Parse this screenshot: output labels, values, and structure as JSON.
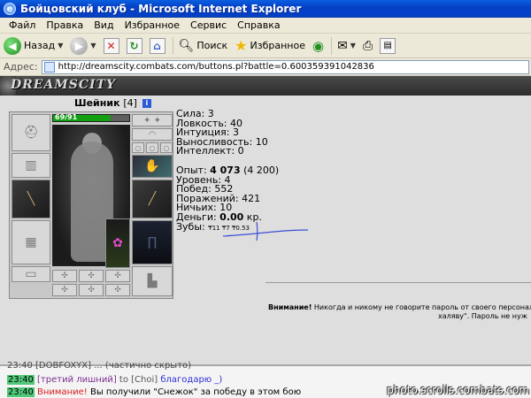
{
  "window": {
    "title": "Бойцовский клуб - Microsoft Internet Explorer"
  },
  "menu": [
    "Файл",
    "Правка",
    "Вид",
    "Избранное",
    "Сервис",
    "Справка"
  ],
  "toolbar": {
    "back": "Назад",
    "search": "Поиск",
    "favorites": "Избранное"
  },
  "address": {
    "label": "Адрес:",
    "url": "http://dreamscity.combats.com/buttons.pl?battle=0.600359391042836"
  },
  "site": {
    "logo": "DREAMSCITY"
  },
  "character": {
    "name": "Шейник",
    "level": "[4]",
    "info_icon_label": "i",
    "hp_text": "69/91",
    "hp_fraction": 0.76
  },
  "stats": {
    "sila": "Сила: 3",
    "lovkost": "Ловкость: 40",
    "intuicia": "Интуиция: 3",
    "vynoslivost": "Выносливость: 10",
    "intellekt": "Интеллект: 0",
    "opyt_label": "Опыт: ",
    "opyt_value": "4 073",
    "opyt_next": " (4 200)",
    "uroven": "Уровень: 4",
    "pobed": "Побед: 552",
    "porazhenii": "Поражений: 421",
    "nichih": "Ничьих: 10",
    "dengi_label": "Деньги: ",
    "dengi_value": "0.00",
    "dengi_unit": " кр.",
    "zuby_label": "Зубы: ",
    "zuby_value": "₸11 ₸7 ₸0.53"
  },
  "warning": {
    "bold": "Внимание!",
    "text": " Никогда и никому не говорите пароль от своего персонаж",
    "line2": "халяву\". Пароль не нуж"
  },
  "chat": [
    {
      "time": "23:40",
      "nick": "[третий лишний]",
      "to": "to [Choi]",
      "msg": " благодарю _)"
    },
    {
      "time": "23:40",
      "alert": "Внимание!",
      "msg": " Вы получили \"Снежок\" за победу в этом бою"
    }
  ],
  "chat_cut_top": "23:40 [DOBFOXYX]  ... (частично скрыто)",
  "watermark": "photo.scrolls.combats.com",
  "colors": {
    "titlebar": "#0341c9",
    "hp": "#13a113",
    "chat_time": "#50c878"
  }
}
